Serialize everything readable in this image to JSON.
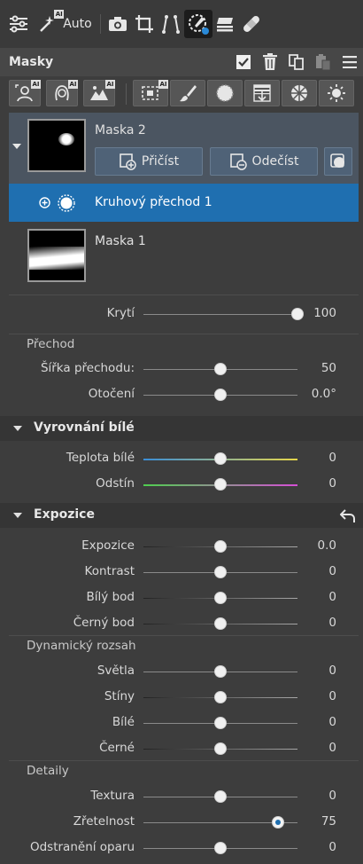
{
  "toolbar": {
    "auto_label": "Auto",
    "ai_badge": "AI",
    "icons": [
      "sliders-icon",
      "magic-wand-icon",
      "camera-icon",
      "crop-icon",
      "perspective-icon",
      "mask-brush-icon",
      "layers-icon",
      "bandage-icon"
    ]
  },
  "panel": {
    "title": "Masky",
    "header_icons": [
      "checkmark-icon",
      "trash-icon",
      "copy-icon",
      "paste-icon",
      "menu-icon"
    ]
  },
  "mask_tools": {
    "ai_badge": "AI",
    "icons": [
      "ai-person-icon",
      "ai-face-icon",
      "ai-landscape-icon",
      "ai-select-icon",
      "brush-icon",
      "radial-gradient-icon",
      "linear-gradient-icon",
      "color-range-icon",
      "luminance-icon"
    ]
  },
  "masks": [
    {
      "name": "Maska 2",
      "add_label": "Přičíst",
      "subtract_label": "Odečíst"
    },
    {
      "name": "Maska 1"
    }
  ],
  "selected_submask": "Kruhový přechod 1",
  "opacity": {
    "label": "Krytí",
    "value": "100",
    "pos": 1.0
  },
  "transition": {
    "group_label": "Přechod",
    "width": {
      "label": "Šířka přechodu:",
      "value": "50",
      "pos": 0.5
    },
    "rotation": {
      "label": "Otočení",
      "value": "0.0°",
      "pos": 0.5
    }
  },
  "white_balance": {
    "title": "Vyrovnání bílé",
    "temp": {
      "label": "Teplota bílé",
      "value": "0",
      "pos": 0.5
    },
    "tint": {
      "label": "Odstín",
      "value": "0",
      "pos": 0.5
    }
  },
  "exposure": {
    "title": "Expozice",
    "exposure": {
      "label": "Expozice",
      "value": "0.0",
      "pos": 0.5
    },
    "contrast": {
      "label": "Kontrast",
      "value": "0",
      "pos": 0.5
    },
    "white_point": {
      "label": "Bílý bod",
      "value": "0",
      "pos": 0.5
    },
    "black_point": {
      "label": "Černý bod",
      "value": "0",
      "pos": 0.5
    },
    "dynamic_range_label": "Dynamický rozsah",
    "highlights": {
      "label": "Světla",
      "value": "0",
      "pos": 0.5
    },
    "shadows": {
      "label": "Stíny",
      "value": "0",
      "pos": 0.5
    },
    "whites": {
      "label": "Bílé",
      "value": "0",
      "pos": 0.5
    },
    "blacks": {
      "label": "Černé",
      "value": "0",
      "pos": 0.5
    },
    "details_label": "Detaily",
    "texture": {
      "label": "Textura",
      "value": "0",
      "pos": 0.5
    },
    "clarity": {
      "label": "Zřetelnost",
      "value": "75",
      "pos": 0.875
    },
    "dehaze": {
      "label": "Odstranění oparu",
      "value": "0",
      "pos": 0.5
    }
  },
  "colors": {
    "accent": "#1f6fb0",
    "panel_bg": "#3d3d3d",
    "section_bg": "#353535"
  }
}
